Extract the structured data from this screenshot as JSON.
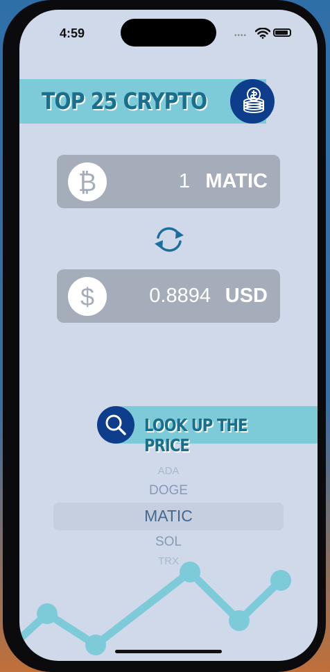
{
  "status_bar": {
    "time": "4:59",
    "signal_dots": "••••"
  },
  "header": {
    "title": "TOP 25 CRYPTO",
    "icon": "coins-icon"
  },
  "converter": {
    "crypto": {
      "amount": "1",
      "symbol": "MATIC",
      "icon": "bitcoin-icon"
    },
    "swap_icon": "swap-arrows-icon",
    "fiat": {
      "amount": "0.8894",
      "symbol": "USD",
      "icon": "dollar-icon"
    }
  },
  "lookup": {
    "label": "LOOK UP THE PRICE",
    "icon": "search-icon"
  },
  "picker": {
    "items": [
      "ADA",
      "DOGE",
      "MATIC",
      "SOL",
      "TRX"
    ],
    "selected": "MATIC"
  },
  "colors": {
    "background": "#d0d9ea",
    "accent": "#7dcbd9",
    "brand_dark": "#0e3d8c",
    "field": "#a6adba",
    "title_text": "#1b6f8c"
  }
}
